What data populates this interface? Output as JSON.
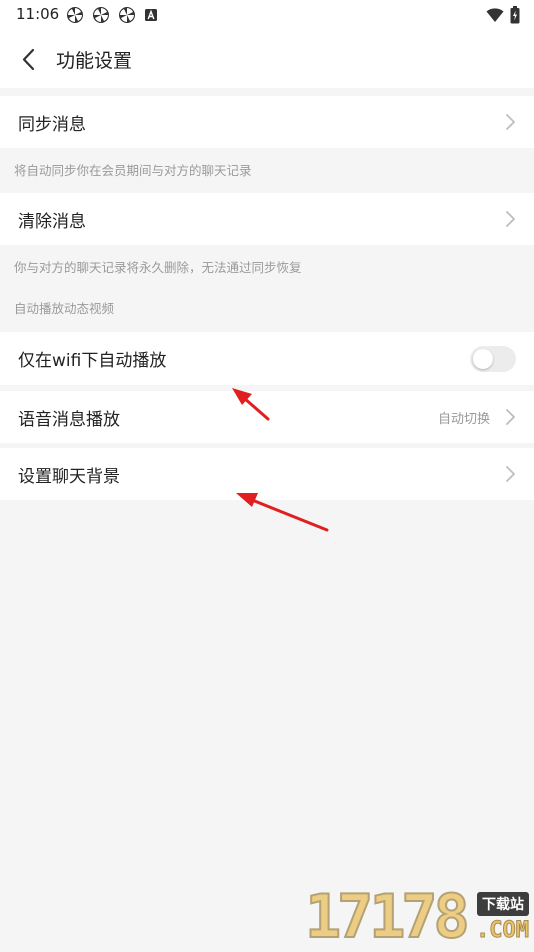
{
  "status_bar": {
    "time": "11:06",
    "icons": [
      "pinwheel-icon",
      "pinwheel-icon",
      "pinwheel-icon",
      "a-badge-icon"
    ],
    "right_icons": [
      "wifi-icon",
      "battery-icon"
    ]
  },
  "header": {
    "title": "功能设置",
    "back_icon": "chevron-left-icon"
  },
  "settings": {
    "sync": {
      "label": "同步消息",
      "desc": "将自动同步你在会员期间与对方的聊天记录"
    },
    "clear": {
      "label": "清除消息",
      "desc": "你与对方的聊天记录将永久删除，无法通过同步恢复"
    },
    "video_section": {
      "title": "自动播放动态视频"
    },
    "wifi_autoplay": {
      "label": "仅在wifi下自动播放",
      "enabled": false
    },
    "voice_playback": {
      "label": "语音消息播放",
      "value": "自动切换"
    },
    "chat_background": {
      "label": "设置聊天背景"
    }
  },
  "annotations": {
    "arrow_color": "#e02020"
  },
  "watermark": {
    "digits": "17178",
    "tag": "下载站",
    "suffix": ".COM"
  },
  "colors": {
    "background": "#f5f5f5",
    "card": "#ffffff",
    "secondary_text": "#9a9a9a"
  }
}
